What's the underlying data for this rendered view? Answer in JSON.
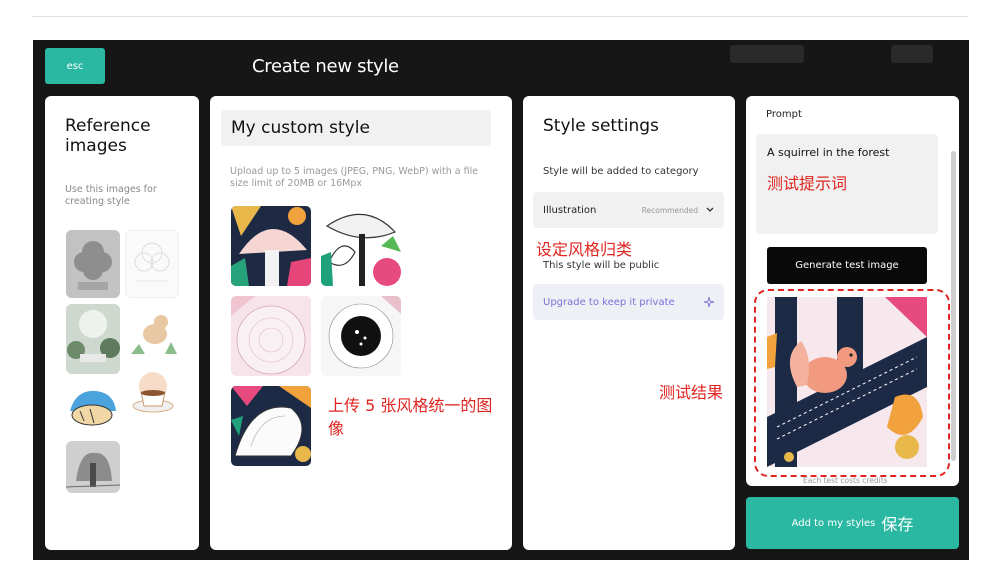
{
  "header": {
    "esc_label": "esc",
    "title": "Create new style"
  },
  "reference": {
    "title": "Reference images",
    "subtitle": "Use this images for creating style"
  },
  "custom": {
    "name": "My custom style",
    "upload_note": "Upload up to 5 images (JPEG, PNG, WebP) with a file size limit of 20MB or 16Mpx",
    "annotation": "上传 5 张风格统一的图像"
  },
  "settings": {
    "title": "Style settings",
    "category_label": "Style will be added to category",
    "category_value": "Illustration",
    "category_badge": "Recommended",
    "annotation": "设定风格归类",
    "public_note": "This style will be public",
    "upgrade_label": "Upgrade to keep it private"
  },
  "test": {
    "prompt_label": "Prompt",
    "prompt_value": "A squirrel in the forest",
    "prompt_annotation": "测试提示词",
    "generate_label": "Generate test image",
    "credits_note": "Each test costs credits",
    "result_annotation": "测试结果"
  },
  "footer": {
    "add_label": "Add to my styles",
    "add_annotation": "保存"
  },
  "colors": {
    "accent": "#2ab8a3",
    "annotation_red": "#e0241f",
    "frame": "#161616"
  }
}
